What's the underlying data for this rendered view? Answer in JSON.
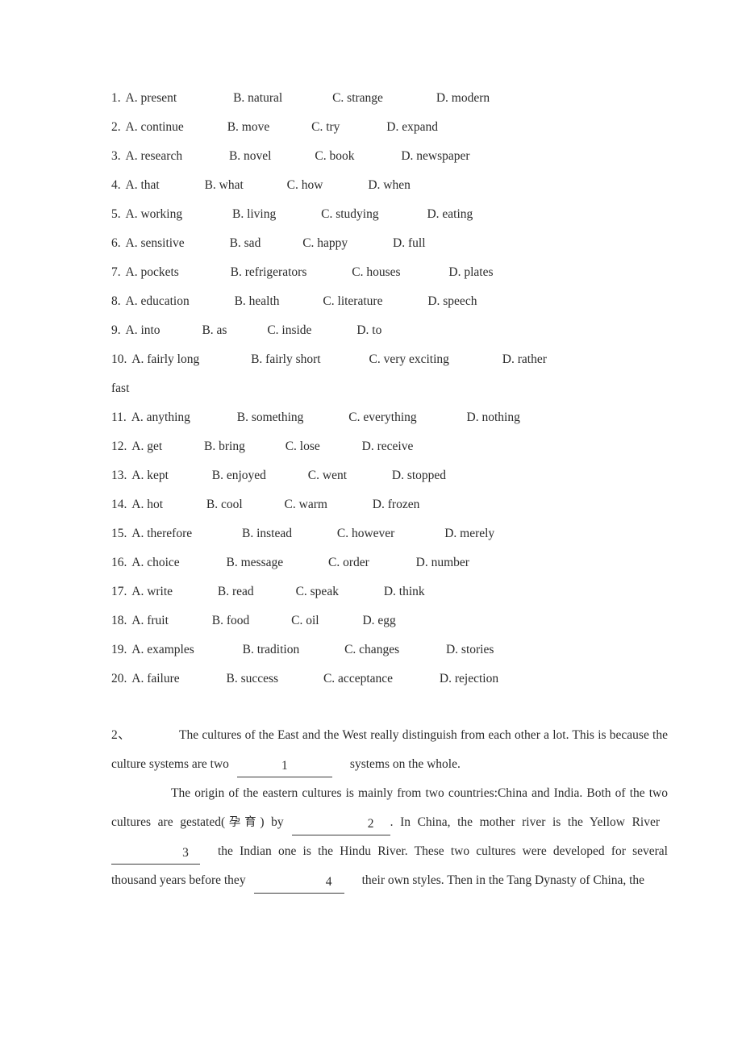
{
  "document": {
    "type": "english-cloze-worksheet",
    "text_color": "#2b2b2b",
    "background_color": "#ffffff"
  },
  "options_section": {
    "rows": [
      {
        "num": "1.",
        "a": "A. present",
        "b": "B. natural",
        "c": "C. strange",
        "d": "D. modern"
      },
      {
        "num": "2.",
        "a": "A. continue",
        "b": "B. move",
        "c": "C. try",
        "d": "D. expand"
      },
      {
        "num": "3.",
        "a": "A. research",
        "b": "B. novel",
        "c": "C. book",
        "d": "D. newspaper"
      },
      {
        "num": "4.",
        "a": "A. that",
        "b": "B. what",
        "c": "C. how",
        "d": "D. when"
      },
      {
        "num": "5.",
        "a": "A. working",
        "b": "B. living",
        "c": "C. studying",
        "d": "D. eating"
      },
      {
        "num": "6.",
        "a": "A. sensitive",
        "b": "B. sad",
        "c": "C. happy",
        "d": "D. full"
      },
      {
        "num": "7.",
        "a": "A. pockets",
        "b": "B. refrigerators",
        "c": "C. houses",
        "d": "D. plates"
      },
      {
        "num": "8.",
        "a": "A. education",
        "b": "B. health",
        "c": "C. literature",
        "d": "D. speech"
      },
      {
        "num": "9.",
        "a": "A. into",
        "b": "B. as",
        "c": "C. inside",
        "d": "D. to"
      },
      {
        "num": "10.",
        "a": "A. fairly long",
        "b": "B. fairly short",
        "c": "C. very exciting",
        "d": "D. rather",
        "wrap_tail": "fast"
      },
      {
        "num": "11.",
        "a": "A. anything",
        "b": "B. something",
        "c": "C. everything",
        "d": "D. nothing"
      },
      {
        "num": "12.",
        "a": "A. get",
        "b": "B. bring",
        "c": "C. lose",
        "d": "D. receive"
      },
      {
        "num": "13.",
        "a": "A. kept",
        "b": "B. enjoyed",
        "c": "C. went",
        "d": "D. stopped"
      },
      {
        "num": "14.",
        "a": "A. hot",
        "b": "B. cool",
        "c": "C. warm",
        "d": "D. frozen"
      },
      {
        "num": "15.",
        "a": "A. therefore",
        "b": "B. instead",
        "c": "C. however",
        "d": "D. merely"
      },
      {
        "num": "16.",
        "a": "A. choice",
        "b": "B. message",
        "c": "C. order",
        "d": "D. number"
      },
      {
        "num": "17.",
        "a": "A. write",
        "b": "B. read",
        "c": "C. speak",
        "d": "D. think"
      },
      {
        "num": "18.",
        "a": "A. fruit",
        "b": "B. food",
        "c": "C. oil",
        "d": "D. egg"
      },
      {
        "num": "19.",
        "a": "A. examples",
        "b": "B. tradition",
        "c": "C. changes",
        "d": "D. stories"
      },
      {
        "num": "20.",
        "a": "A. failure",
        "b": "B. success",
        "c": "C. acceptance",
        "d": "D. rejection"
      }
    ]
  },
  "passage": {
    "item_marker": "2、",
    "paragraph_1": {
      "text_before_blank": "The cultures of the East and the West really distinguish from each other a lot. This is because the culture systems are two",
      "blank_number": "1",
      "text_after_blank": "systems on the whole."
    },
    "paragraph_2": {
      "segment_1": "The origin of the eastern cultures is mainly from two countries:China and India. Both of the two cultures are gestated(",
      "cjk_gloss": "孕育",
      "segment_2": ") by",
      "blank_number_2": "2",
      "segment_3": ". In China, the mother river is the Yellow River",
      "blank_number_3": "3",
      "segment_4": "the Indian one is the Hindu River. These two cultures were developed for several thousand years before they",
      "blank_number_4": "4",
      "segment_5": "their own styles. Then in the Tang Dynasty of China, the"
    }
  }
}
